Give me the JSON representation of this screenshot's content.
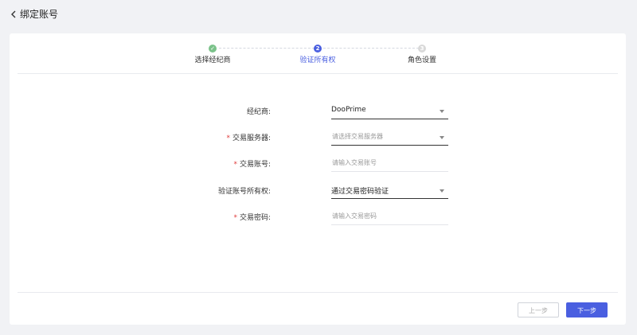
{
  "header": {
    "title": "绑定账号",
    "back_icon": "chevron-left-icon"
  },
  "steps": [
    {
      "label": "选择经纪商",
      "status": "done",
      "marker": "✓"
    },
    {
      "label": "验证所有权",
      "status": "active",
      "marker": "2"
    },
    {
      "label": "角色设置",
      "status": "todo",
      "marker": "3"
    }
  ],
  "form": {
    "broker": {
      "label": "经纪商:",
      "required": false,
      "value": "DooPrime",
      "type": "select"
    },
    "server": {
      "label": "交易服务器:",
      "required": true,
      "placeholder": "请选择交易服务器",
      "type": "select"
    },
    "account": {
      "label": "交易账号:",
      "required": true,
      "placeholder": "请输入交易账号",
      "type": "input"
    },
    "verify_method": {
      "label": "验证账号所有权:",
      "required": false,
      "value": "通过交易密码验证",
      "type": "select"
    },
    "password": {
      "label": "交易密码:",
      "required": true,
      "placeholder": "请输入交易密码",
      "type": "input"
    }
  },
  "footer": {
    "prev_label": "上一步",
    "next_label": "下一步"
  },
  "colors": {
    "accent": "#4a5fe0",
    "done": "#7bc28a",
    "required": "#e03c3c"
  }
}
